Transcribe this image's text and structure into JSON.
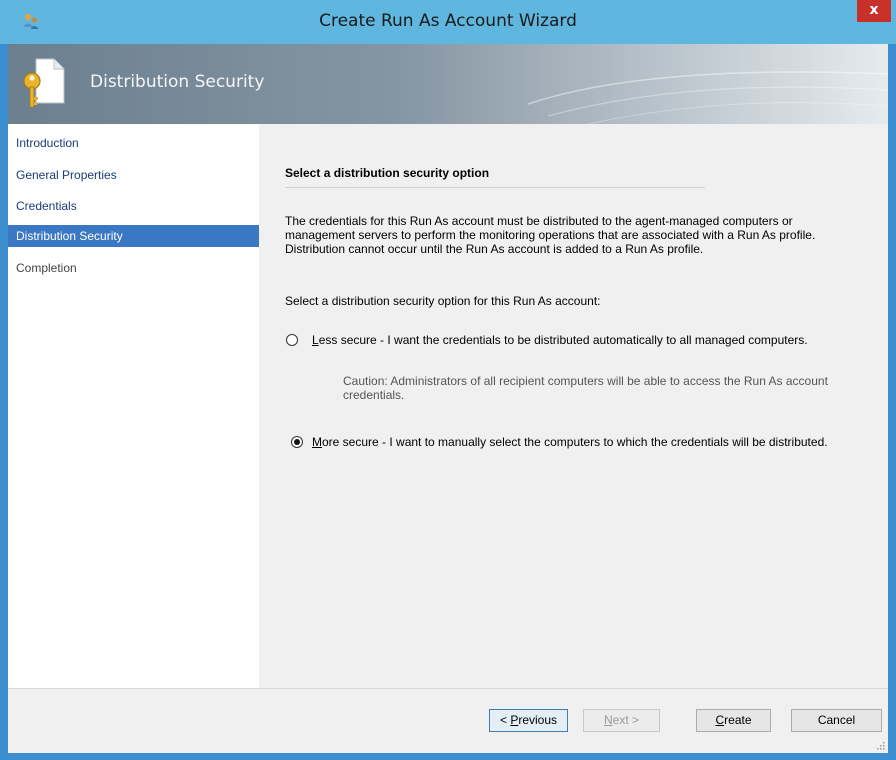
{
  "window": {
    "title": "Create Run As Account Wizard",
    "close_label": "x"
  },
  "header": {
    "title": "Distribution Security"
  },
  "nav": {
    "items": [
      {
        "label": "Introduction"
      },
      {
        "label": "General Properties"
      },
      {
        "label": "Credentials"
      },
      {
        "label": "Distribution Security"
      },
      {
        "label": "Completion"
      }
    ]
  },
  "main": {
    "section_title": "Select a distribution security option",
    "description": "The credentials for this Run As account must be distributed to the agent-managed computers or management servers to perform the monitoring operations that are associated with a Run As profile. Distribution cannot occur until the Run As account is added to a Run As profile.",
    "prompt": "Select a distribution security option for this Run As account:",
    "option_less": {
      "mnemonic": "L",
      "rest": "ess secure - I want the credentials to be distributed automatically to all managed computers.",
      "selected": false
    },
    "caution": "Caution: Administrators of all recipient computers will be able to access the Run As account credentials.",
    "option_more": {
      "mnemonic": "M",
      "rest": "ore secure - I want to manually select the computers to which the credentials will be distributed.",
      "selected": true
    }
  },
  "buttons": {
    "previous": {
      "prefix": "< ",
      "mnemonic": "P",
      "rest": "revious"
    },
    "next": {
      "mnemonic": "N",
      "rest": "ext >",
      "enabled": false
    },
    "create": {
      "mnemonic": "C",
      "rest": "reate"
    },
    "cancel": {
      "label": "Cancel"
    }
  },
  "colors": {
    "titlebar": "#5fb7e0",
    "accent": "#3b78c3",
    "close": "#c7312a"
  }
}
